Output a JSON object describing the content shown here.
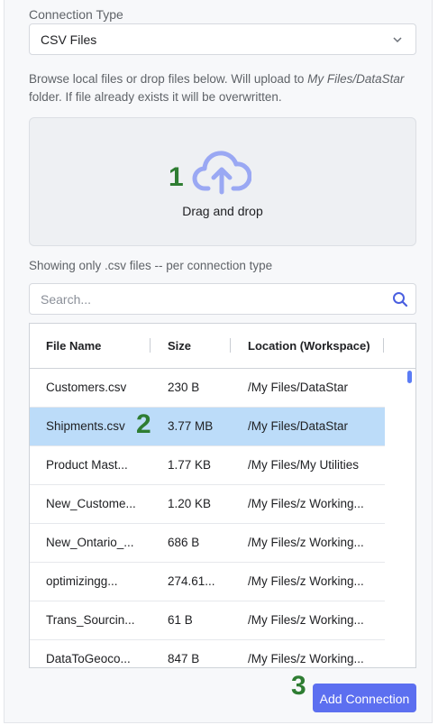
{
  "connection": {
    "label": "Connection Type",
    "value": "CSV Files"
  },
  "info": {
    "prefix": "Browse local files or drop files below. Will upload to ",
    "path": "My Files/DataStar",
    "suffix": " folder. If file already exists it will be overwritten."
  },
  "dropzone": {
    "label": "Drag and drop",
    "step": "1"
  },
  "filter_note": "Showing only .csv files -- per connection type",
  "search": {
    "placeholder": "Search..."
  },
  "table": {
    "headers": [
      "File Name",
      "Size",
      "Location (Workspace)"
    ],
    "rows": [
      {
        "name": "Customers.csv",
        "size": "230 B",
        "location": "/My Files/DataStar"
      },
      {
        "name": "Shipments.csv",
        "size": "3.77 MB",
        "location": "/My Files/DataStar"
      },
      {
        "name": "Product Mast...",
        "size": "1.77 KB",
        "location": "/My Files/My Utilities"
      },
      {
        "name": "New_Custome...",
        "size": "1.20 KB",
        "location": "/My Files/z Working..."
      },
      {
        "name": "New_Ontario_...",
        "size": "686 B",
        "location": "/My Files/z Working..."
      },
      {
        "name": "optimizingg...",
        "size": "274.61...",
        "location": "/My Files/z Working..."
      },
      {
        "name": "Trans_Sourcin...",
        "size": "61 B",
        "location": "/My Files/z Working..."
      },
      {
        "name": "DataToGeoco...",
        "size": "847 B",
        "location": "/My Files/z Working..."
      }
    ],
    "selected_row_step": "2"
  },
  "add_button": {
    "label": "Add Connection",
    "step": "3"
  },
  "colors": {
    "accent": "#5c6ff0",
    "selected_row": "#bcdcf9",
    "step_number": "#2e7d32"
  }
}
